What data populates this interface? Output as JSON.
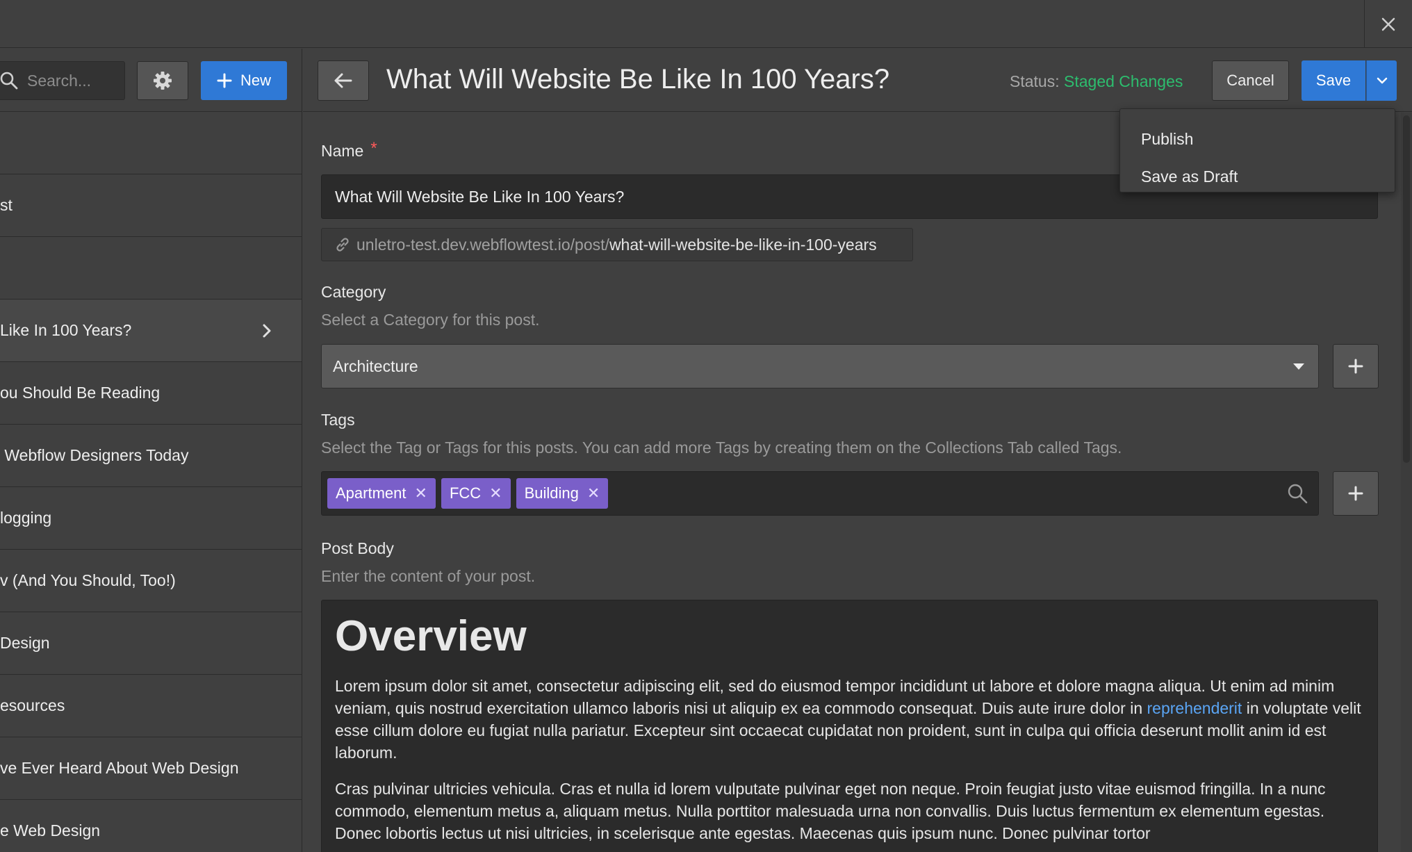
{
  "sidebar": {
    "search_placeholder": "Search...",
    "new_label": "New",
    "items": [
      {
        "label": ""
      },
      {
        "label": "st"
      },
      {
        "label": ""
      },
      {
        "label": "Like In 100 Years?"
      },
      {
        "label": "ou Should Be Reading"
      },
      {
        "label": " Webflow Designers Today"
      },
      {
        "label": "logging"
      },
      {
        "label": "v (And You Should, Too!)"
      },
      {
        "label": "Design"
      },
      {
        "label": "esources"
      },
      {
        "label": "ve Ever Heard About Web Design"
      },
      {
        "label": "e Web Design"
      }
    ]
  },
  "header": {
    "title": "What Will Website Be Like In 100 Years?",
    "status_label": "Status:",
    "status_value": "Staged Changes",
    "cancel_label": "Cancel",
    "save_label": "Save"
  },
  "save_menu": {
    "items": [
      "Publish",
      "Save as Draft"
    ]
  },
  "form": {
    "name": {
      "label": "Name",
      "required_mark": "*",
      "value": "What Will Website Be Like In 100 Years?"
    },
    "slug": {
      "base": "unletro-test.dev.webflowtest.io/post/",
      "path": "what-will-website-be-like-in-100-years"
    },
    "category": {
      "label": "Category",
      "help": "Select a Category for this post.",
      "value": "Architecture"
    },
    "tags": {
      "label": "Tags",
      "help": "Select the Tag or Tags for this posts. You can add more Tags by creating them on the Collections Tab called Tags.",
      "items": [
        "Apartment",
        "FCC",
        "Building"
      ]
    },
    "post_body": {
      "label": "Post Body",
      "help": "Enter the content of your post.",
      "heading": "Overview",
      "p1_before": "Lorem ipsum dolor sit amet, consectetur adipiscing elit, sed do eiusmod tempor incididunt ut labore et dolore magna aliqua. Ut enim ad minim veniam, quis nostrud exercitation ullamco laboris nisi ut aliquip ex ea commodo consequat. Duis aute irure dolor in ",
      "p1_link": "reprehenderit",
      "p1_after": " in voluptate velit esse cillum dolore eu fugiat nulla pariatur. Excepteur sint occaecat cupidatat non proident, sunt in culpa qui officia deserunt mollit anim id est laborum.",
      "p2": "Cras pulvinar ultricies vehicula. Cras et nulla id lorem vulputate pulvinar eget non neque. Proin feugiat justo vitae euismod fringilla. In a nunc commodo, elementum metus a, aliquam metus. Nulla porttitor malesuada urna non convallis. Duis luctus fermentum ex elementum egestas. Donec lobortis lectus ut nisi ultricies, in scelerisque ante egestas. Maecenas quis ipsum nunc. Donec pulvinar tortor"
    }
  },
  "colors": {
    "accent": "#2f79d6",
    "status_green": "#2dbd6e",
    "tag_purple": "#7a5fc9",
    "required_red": "#ff5a5a",
    "link": "#5aa5f5"
  },
  "icons": [
    "close-icon",
    "search-icon",
    "gear-icon",
    "plus-icon",
    "chevron-right-icon",
    "arrow-left-icon",
    "chevron-down-icon",
    "link-icon",
    "caret-down-icon",
    "tag-remove-icon"
  ]
}
